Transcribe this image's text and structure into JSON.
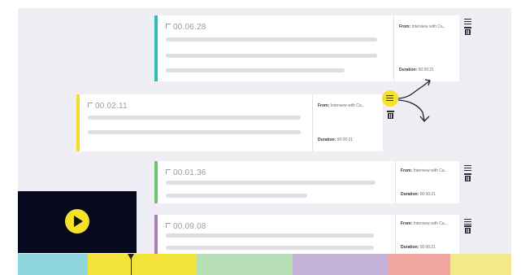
{
  "clips": [
    {
      "id": "clip-1",
      "time": "00.06.28",
      "from_label": "From:",
      "from_value": "Interview with Ca...",
      "duration_label": "Duration:",
      "duration_value": "00:00:21",
      "color": "#29bfb3"
    },
    {
      "id": "clip-2",
      "time": "00.02.11",
      "from_label": "From:",
      "from_value": "Interview with Ca...",
      "duration_label": "Duration:",
      "duration_value": "00:00:21",
      "color": "#f3dc2a"
    },
    {
      "id": "clip-3",
      "time": "00.01.36",
      "from_label": "From:",
      "from_value": "Interview with Ca...",
      "duration_label": "Duration:",
      "duration_value": "00:00:21",
      "color": "#6cc46f"
    },
    {
      "id": "clip-4",
      "time": "00.09.08",
      "from_label": "From:",
      "from_value": "Interview with Ca...",
      "duration_label": "Duration:",
      "duration_value": "00:00:21",
      "color": "#a87db8"
    }
  ],
  "icons": {
    "menu": "hamburger-icon",
    "delete": "trash-icon",
    "play": "play-icon"
  },
  "timeline": {
    "segments": [
      "#8fd5dd",
      "#f3e23a",
      "#b6dfb5",
      "#c6b3d9",
      "#f0a5a0",
      "#f4e98a"
    ]
  }
}
